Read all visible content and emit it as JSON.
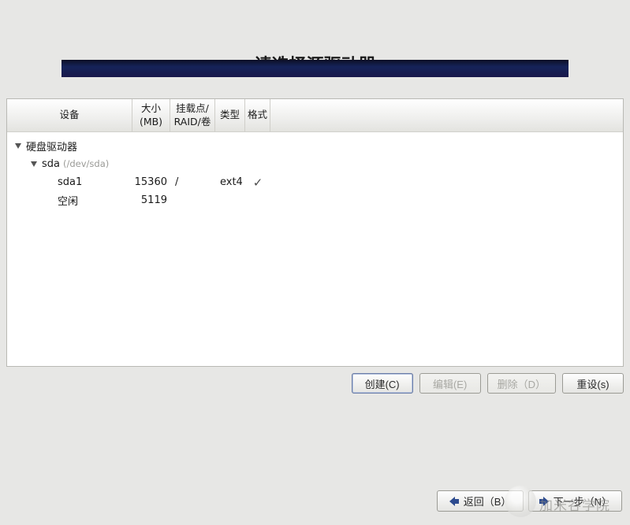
{
  "title": "请选择源驱动器",
  "columns": {
    "device": "设备",
    "size_l1": "大小",
    "size_l2": "(MB)",
    "mount_l1": "挂载点/",
    "mount_l2": "RAID/卷",
    "type": "类型",
    "format": "格式"
  },
  "tree": {
    "root_label": "硬盘驱动器",
    "disk_label": "sda",
    "disk_path": "(/dev/sda)",
    "rows": [
      {
        "name": "sda1",
        "size": "15360",
        "mount": "/",
        "type": "ext4",
        "formatted": true
      },
      {
        "name": "空闲",
        "size": "5119",
        "mount": "",
        "type": "",
        "formatted": false
      }
    ]
  },
  "buttons": {
    "create": "创建(C)",
    "edit": "编辑(E)",
    "delete": "删除（D）",
    "reset": "重设(s)",
    "back": "返回（B）",
    "next": "下一步（N）"
  },
  "watermark_text": "加米谷学院"
}
